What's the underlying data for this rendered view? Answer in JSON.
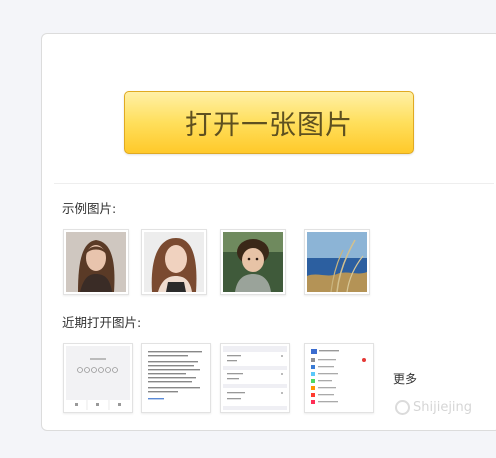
{
  "open_button": {
    "label": "打开一张图片"
  },
  "sample_section": {
    "label": "示例图片:",
    "items": [
      {
        "icon": "portrait-woman-photo"
      },
      {
        "icon": "portrait-girl-photo"
      },
      {
        "icon": "child-photo"
      },
      {
        "icon": "grass-sea-photo"
      }
    ]
  },
  "recent_section": {
    "label": "近期打开图片:",
    "items": [
      {
        "icon": "passcode-screenshot"
      },
      {
        "icon": "article-screenshot"
      },
      {
        "icon": "settings-screenshot"
      },
      {
        "icon": "app-list-screenshot"
      }
    ],
    "more_label": "更多"
  },
  "watermark": {
    "text": "Shijiejing"
  }
}
